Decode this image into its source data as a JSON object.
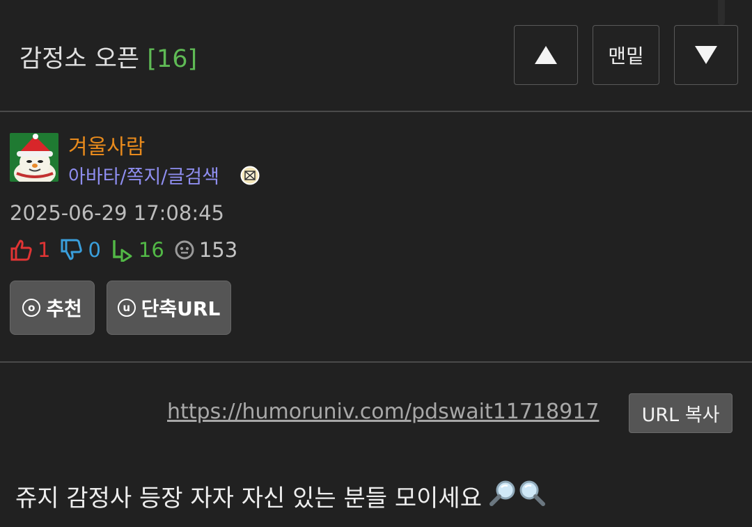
{
  "header": {
    "title": "감정소 오픈",
    "comment_count": "[16]",
    "bottom_label": "맨밑",
    "up_icon": "triangle-up-icon",
    "down_icon": "triangle-down-icon"
  },
  "author": {
    "name": "겨울사람",
    "links": "아바타/쪽지/글검색",
    "avatar_icon": "snowman-avatar",
    "mail_icon": "envelope-icon"
  },
  "post": {
    "datetime": "2025-06-29 17:08:45",
    "stats": {
      "likes": "1",
      "dislikes": "0",
      "comments": "16",
      "views": "153"
    },
    "recommend_label": "추천",
    "recommend_icon_char": "o",
    "shorturl_label": "단축URL",
    "shorturl_icon_char": "u",
    "url": "https://humoruniv.com/pdswait11718917",
    "copy_label": "URL 복사",
    "body_text": "쥬지 감정사 등장 자자 자신 있는 분들 모이세요"
  },
  "colors": {
    "background": "#212121",
    "count_green": "#5fba55",
    "author_orange": "#e88a1c",
    "link_purple": "#8f8ef0",
    "like_red": "#e03434",
    "dislike_blue": "#3a9fdc",
    "reply_green": "#52b846"
  }
}
